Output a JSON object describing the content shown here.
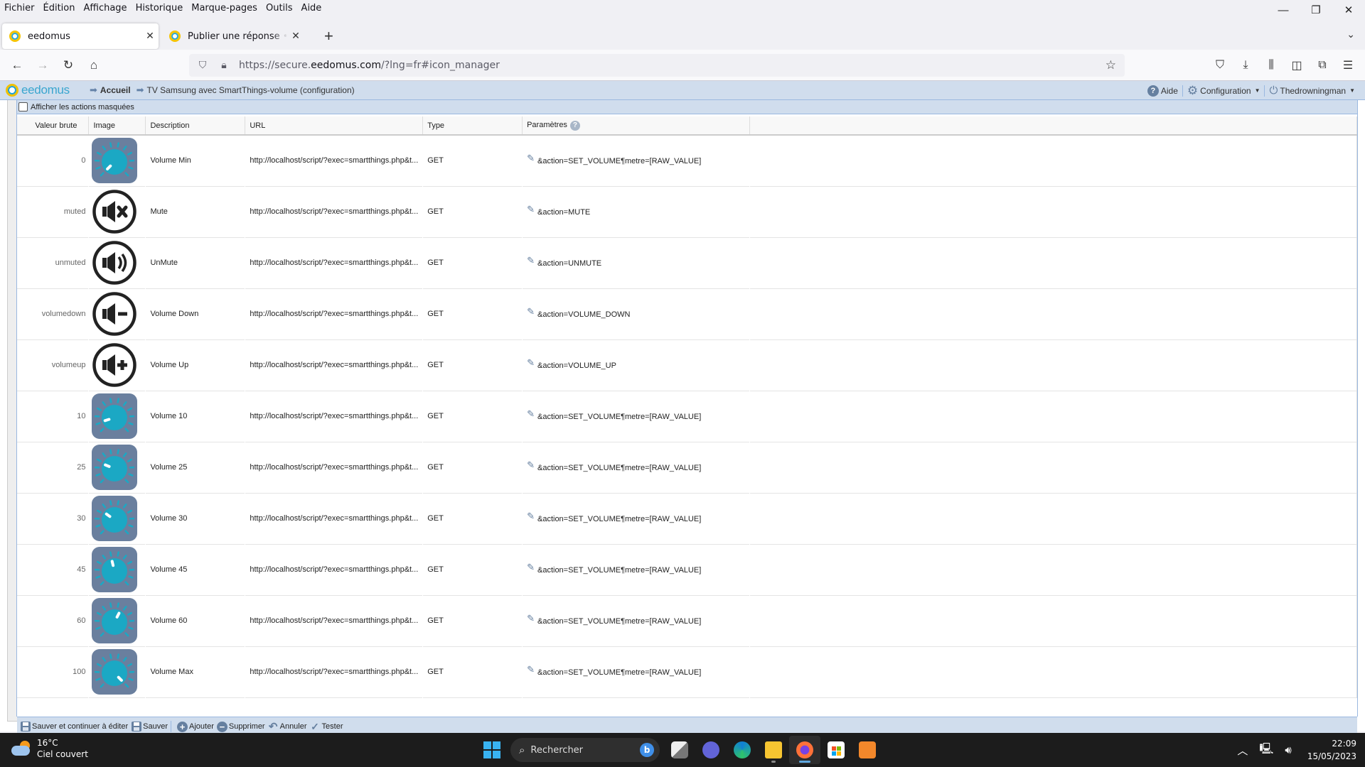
{
  "menu": [
    "Fichier",
    "Édition",
    "Affichage",
    "Historique",
    "Marque-pages",
    "Outils",
    "Aide"
  ],
  "window_controls": {
    "minimize": "—",
    "restore": "❐",
    "close": "✕"
  },
  "tabs": [
    {
      "title": "eedomus",
      "active": true,
      "close": "✕"
    },
    {
      "title": "Publier une réponse • Forum eedomus",
      "active": false,
      "close": "✕"
    }
  ],
  "new_tab": "+",
  "tab_list": "⌄",
  "nav": {
    "back": "←",
    "forward": "→",
    "reload": "↻",
    "home": "⌂"
  },
  "url": {
    "prefix": "https://secure.",
    "domain": "eedomus.com",
    "suffix": "/?lng=fr#icon_manager"
  },
  "toolbar_icons": [
    "pocket-icon",
    "download-icon",
    "library-icon",
    "sidebar-icon",
    "extensions-icon",
    "menu-icon"
  ],
  "eedomus": {
    "logo": "eedomus",
    "breadcrumb": [
      {
        "label": "Accueil",
        "home": true
      },
      {
        "label": "TV Samsung avec SmartThings-volume (configuration)",
        "home": false
      }
    ],
    "right": {
      "help": "Aide",
      "config": "Configuration",
      "user": "Thedrowningman"
    },
    "show_hidden_label": "Afficher les actions masquées",
    "show_hidden_checked": false,
    "columns": [
      "Valeur brute",
      "Image",
      "Description",
      "URL",
      "Type",
      "Paramètres"
    ],
    "rows": [
      {
        "raw": "0",
        "icon": "knob",
        "knob_level": 0,
        "description": "Volume Min",
        "url": "http://localhost/script/?exec=smartthings.php&t...",
        "type": "GET",
        "params": "&action=SET_VOLUME¶metre=[RAW_VALUE]"
      },
      {
        "raw": "muted",
        "icon": "mute",
        "description": "Mute",
        "url": "http://localhost/script/?exec=smartthings.php&t...",
        "type": "GET",
        "params": "&action=MUTE"
      },
      {
        "raw": "unmuted",
        "icon": "unmute",
        "description": "UnMute",
        "url": "http://localhost/script/?exec=smartthings.php&t...",
        "type": "GET",
        "params": "&action=UNMUTE"
      },
      {
        "raw": "volumedown",
        "icon": "volume-down",
        "description": "Volume Down",
        "url": "http://localhost/script/?exec=smartthings.php&t...",
        "type": "GET",
        "params": "&action=VOLUME_DOWN"
      },
      {
        "raw": "volumeup",
        "icon": "volume-up",
        "description": "Volume Up",
        "url": "http://localhost/script/?exec=smartthings.php&t...",
        "type": "GET",
        "params": "&action=VOLUME_UP"
      },
      {
        "raw": "10",
        "icon": "knob",
        "knob_level": 10,
        "description": "Volume 10",
        "url": "http://localhost/script/?exec=smartthings.php&t...",
        "type": "GET",
        "params": "&action=SET_VOLUME¶metre=[RAW_VALUE]"
      },
      {
        "raw": "25",
        "icon": "knob",
        "knob_level": 25,
        "description": "Volume 25",
        "url": "http://localhost/script/?exec=smartthings.php&t...",
        "type": "GET",
        "params": "&action=SET_VOLUME¶metre=[RAW_VALUE]"
      },
      {
        "raw": "30",
        "icon": "knob",
        "knob_level": 30,
        "description": "Volume 30",
        "url": "http://localhost/script/?exec=smartthings.php&t...",
        "type": "GET",
        "params": "&action=SET_VOLUME¶metre=[RAW_VALUE]"
      },
      {
        "raw": "45",
        "icon": "knob",
        "knob_level": 45,
        "description": "Volume 45",
        "url": "http://localhost/script/?exec=smartthings.php&t...",
        "type": "GET",
        "params": "&action=SET_VOLUME¶metre=[RAW_VALUE]"
      },
      {
        "raw": "60",
        "icon": "knob",
        "knob_level": 60,
        "description": "Volume 60",
        "url": "http://localhost/script/?exec=smartthings.php&t...",
        "type": "GET",
        "params": "&action=SET_VOLUME¶metre=[RAW_VALUE]"
      },
      {
        "raw": "100",
        "icon": "knob",
        "knob_level": 100,
        "description": "Volume Max",
        "url": "http://localhost/script/?exec=smartthings.php&t...",
        "type": "GET",
        "params": "&action=SET_VOLUME¶metre=[RAW_VALUE]"
      }
    ],
    "footer": {
      "save_continue": "Sauver et continuer à éditer",
      "save": "Sauver",
      "add": "Ajouter",
      "delete": "Supprimer",
      "cancel": "Annuler",
      "test": "Tester"
    },
    "colors": {
      "header_bg": "#d0dded",
      "accent": "#6680a0",
      "knob_bg": "#6a7f9e",
      "knob_teal": "#1ba8c4"
    }
  },
  "taskbar": {
    "weather_temp": "16°C",
    "weather_desc": "Ciel couvert",
    "search_placeholder": "Rechercher",
    "apps": [
      "task-view",
      "teams",
      "edge",
      "file-explorer",
      "firefox",
      "store",
      "media-player"
    ],
    "active_app": "firefox",
    "time": "22:09",
    "date": "15/05/2023"
  }
}
